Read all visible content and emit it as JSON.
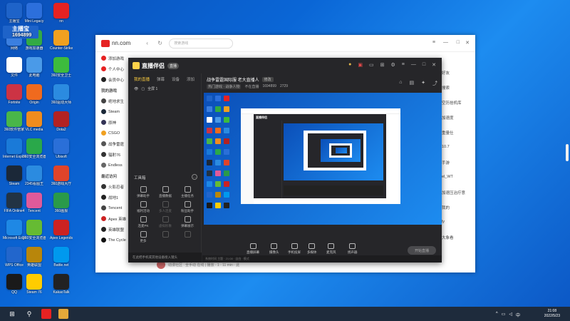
{
  "desktop": {
    "icons": [
      {
        "label": "主播宝",
        "color": "#1e63c9"
      },
      {
        "label": "Mini Legacy",
        "color": "#2c6fdc"
      },
      {
        "label": "nn",
        "color": "#e62222"
      },
      {
        "label": "网络",
        "color": "#3b7fe0"
      },
      {
        "label": "游戏加速器",
        "color": "#33aa44"
      },
      {
        "label": "Counter-Strike Global",
        "color": "#f0a020"
      },
      {
        "label": "文件",
        "color": "#ffffff"
      },
      {
        "label": "此电脑",
        "color": "#4a9ae8"
      },
      {
        "label": "360安全卫士",
        "color": "#3dbb3d"
      },
      {
        "label": "Fortnite",
        "color": "#cc3344"
      },
      {
        "label": "Origin",
        "color": "#f06a1e"
      },
      {
        "label": "360驱动大师",
        "color": "#2b8be0"
      },
      {
        "label": "360软件管家",
        "color": "#49b649"
      },
      {
        "label": "VLC media",
        "color": "#f08c1e"
      },
      {
        "label": "Dota2",
        "color": "#b22222"
      },
      {
        "label": "Internet Explorer",
        "color": "#1a7ad8"
      },
      {
        "label": "360安全浏览器",
        "color": "#2aa84a"
      },
      {
        "label": "Ubisoft",
        "color": "#2a6fd8"
      },
      {
        "label": "Steam",
        "color": "#1b2838"
      },
      {
        "label": "2345看图王",
        "color": "#2b8be0"
      },
      {
        "label": "360游戏大厅",
        "color": "#e0442a"
      },
      {
        "label": "FIFA Online4",
        "color": "#234"
      },
      {
        "label": "Tencent",
        "color": "#e05a9a"
      },
      {
        "label": "360画报",
        "color": "#2a9a4a"
      },
      {
        "label": "Microsoft Edge",
        "color": "#1e88e5"
      },
      {
        "label": "360安全浏览器",
        "color": "#66bb33"
      },
      {
        "label": "Apex Legends",
        "color": "#cc2222"
      },
      {
        "label": "WPS Office",
        "color": "#2266cc"
      },
      {
        "label": "英雄联盟",
        "color": "#b8860b"
      },
      {
        "label": "Battle.net",
        "color": "#0099ee"
      },
      {
        "label": "QQ",
        "color": "#1a1a1a"
      },
      {
        "label": "Steam 76",
        "color": "#ffcc00"
      },
      {
        "label": "KakaoTalk",
        "color": "#222222"
      }
    ],
    "badge_text": "主播宝",
    "badge_number": "1694899"
  },
  "browser": {
    "site": "nn.com",
    "search_placeholder": "搜索游戏",
    "sidebar": [
      {
        "label": "添加游戏",
        "color": "#e62222"
      },
      {
        "label": "个人中心",
        "color": "#e62222"
      },
      {
        "label": "会员中心",
        "color": "#222"
      },
      {
        "label": "我的游戏",
        "color": "",
        "head": true
      },
      {
        "label": "绝地求生",
        "color": "#444"
      },
      {
        "label": "Steam",
        "color": "#1b2838"
      },
      {
        "label": "原神",
        "color": "#335"
      },
      {
        "label": "CSGO",
        "color": "#f0a020"
      },
      {
        "label": "战争雷霆",
        "color": "#555"
      },
      {
        "label": "辐射76",
        "color": "#333"
      },
      {
        "label": "Endless",
        "color": "#666"
      },
      {
        "label": "最近访问",
        "color": "",
        "head": true
      },
      {
        "label": "火影忍者",
        "color": "#333"
      },
      {
        "label": "战地1",
        "color": "#222"
      },
      {
        "label": "Tencent",
        "color": "#444"
      },
      {
        "label": "Apex 英雄",
        "color": "#cc2222"
      },
      {
        "label": "英雄联盟",
        "color": "#222"
      },
      {
        "label": "The Cycle",
        "color": "#111"
      }
    ],
    "right_items": [
      "好友",
      "搜索",
      "空历挂机库",
      "加速度",
      "重量仕",
      "10.7",
      "手游",
      "el_WT",
      "加速压治疗意",
      "我的",
      "ly",
      "大象看"
    ],
    "bottom_user": "动漫社区",
    "bottom_status": "全手动 在线 | 播放 · 1 · 11 min · 此"
  },
  "app": {
    "title": "直播伴侣",
    "pill": "直播",
    "tabs": [
      "我的直播",
      "弹幕",
      "设备",
      "添加"
    ],
    "scene_label": "全屏 1",
    "tools_title": "工具箱",
    "tools": [
      {
        "label": "弹幕助手",
        "dim": false
      },
      {
        "label": "直播数据",
        "dim": false
      },
      {
        "label": "主播任务",
        "dim": false
      },
      {
        "label": "福利活动",
        "dim": false
      },
      {
        "label": "多人连麦",
        "dim": true
      },
      {
        "label": "粉丝助手",
        "dim": false
      },
      {
        "label": "连麦PK",
        "dim": false
      },
      {
        "label": "虚拟形象",
        "dim": true
      },
      {
        "label": "弹幕展示",
        "dim": false
      },
      {
        "label": "更多",
        "dim": false
      },
      {
        "label": "",
        "dim": true
      },
      {
        "label": "",
        "dim": true
      }
    ],
    "hint": "在此把手机或其他设备接入镜头",
    "room_title": "战争雷霆国际服 老大直播人",
    "room_tag": "修改",
    "room_meta": [
      "热门游戏 · 战争人物",
      "不在直播",
      "1694899",
      "2729"
    ],
    "controls": [
      "直播屏幕",
      "摄像头",
      "手机投屏",
      "多媒体",
      "麦克风",
      "扬声器"
    ],
    "start_label": "开始直播",
    "status": "系统时间 主题 · 21:08 · 自由 · 模式",
    "nested_title": "直播伴侣"
  },
  "taskbar": {
    "time": "21:08",
    "date": "2022/5/23"
  }
}
